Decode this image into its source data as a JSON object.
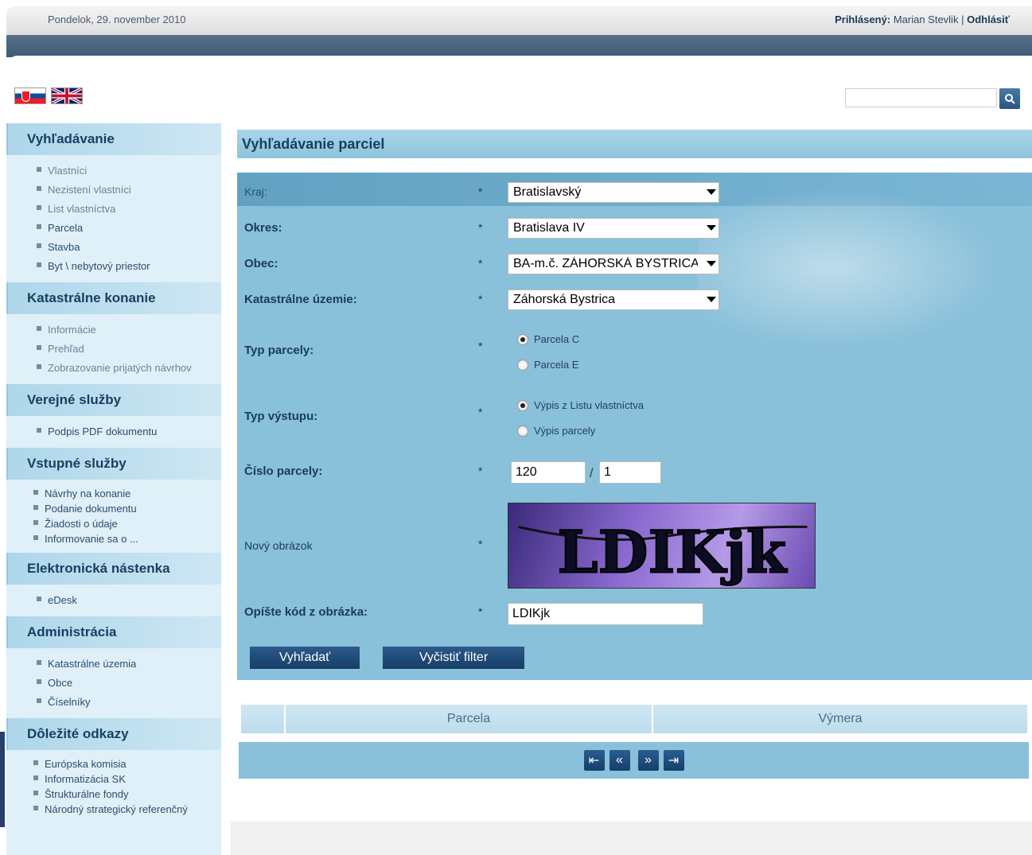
{
  "header": {
    "date": "Pondelok, 29. november 2010",
    "logged_label": "Prihlásený:",
    "user_name": "Marian Stevlik",
    "separator": "|",
    "logout": "Odhlásiť"
  },
  "languages": [
    {
      "code": "sk",
      "icon": "flag-slovakia-icon"
    },
    {
      "code": "en",
      "icon": "flag-uk-icon"
    }
  ],
  "search": {
    "value": "",
    "icon": "search-icon"
  },
  "sidebar": {
    "sections": [
      {
        "title": "Vyhľadávanie",
        "items": [
          "Vlastníci",
          "Nezistení vlastníci",
          "List vlastníctva",
          "Parcela",
          "Stavba",
          "Byt \\ nebytový priestor"
        ]
      },
      {
        "title": "Katastrálne konanie",
        "items": [
          "Informácie",
          "Prehľad",
          "Zobrazovanie prijatých návrhov"
        ]
      },
      {
        "title": "Verejné služby",
        "items": [
          "Podpis PDF dokumentu"
        ]
      },
      {
        "title": "Vstupné služby",
        "items": [
          "Návrhy na konanie",
          "Podanie dokumentu",
          "Žiadosti o údaje",
          "Informovanie sa o ..."
        ]
      },
      {
        "title": "Elektronická nástenka",
        "items": [
          "eDesk"
        ]
      },
      {
        "title": "Administrácia",
        "items": [
          "Katastrálne územia",
          "Obce",
          "Číselníky"
        ]
      },
      {
        "title": "Dôležité odkazy",
        "items": [
          "Európska komisia",
          "Informatizácia SK",
          "Štrukturálne fondy",
          "Národný strategický referenčný"
        ]
      }
    ]
  },
  "main": {
    "title": "Vyhľadávanie parciel",
    "required_mark": "*",
    "fields": {
      "kraj": {
        "label": "Kraj:",
        "value": "Bratislavský"
      },
      "okres": {
        "label": "Okres:",
        "value": "Bratislava IV"
      },
      "obec": {
        "label": "Obec:",
        "value": "BA-m.č. ZÁHORSKÁ BYSTRICA"
      },
      "katastralne_uzemie": {
        "label": "Katastrálne územie:",
        "value": "Záhorská Bystrica"
      },
      "typ_parcely": {
        "label": "Typ parcely:",
        "options": [
          "Parcela C",
          "Parcela E"
        ],
        "selected": "Parcela C"
      },
      "typ_vystupu": {
        "label": "Typ výstupu:",
        "options": [
          "Výpis z Listu vlastníctva",
          "Výpis parcely"
        ],
        "selected": "Výpis z Listu vlastníctva"
      },
      "cislo_parcely": {
        "label": "Číslo parcely:",
        "number": "120",
        "separator": "/",
        "sub": "1"
      },
      "captcha": {
        "label": "Nový obrázok",
        "text": "LDIKjk"
      },
      "code": {
        "label": "Opíšte kód z obrázka:",
        "value": "LDIKjk"
      }
    },
    "buttons": {
      "search": "Vyhľadať",
      "clear": "Vyčistiť filter"
    },
    "results": {
      "columns": [
        "",
        "Parcela",
        "Výmera"
      ]
    },
    "pager": [
      {
        "icon": "first-page-icon",
        "glyph": "⇤"
      },
      {
        "icon": "previous-page-icon",
        "glyph": "«"
      },
      {
        "icon": "next-page-icon",
        "glyph": "»"
      },
      {
        "icon": "last-page-icon",
        "glyph": "⇥"
      }
    ]
  }
}
